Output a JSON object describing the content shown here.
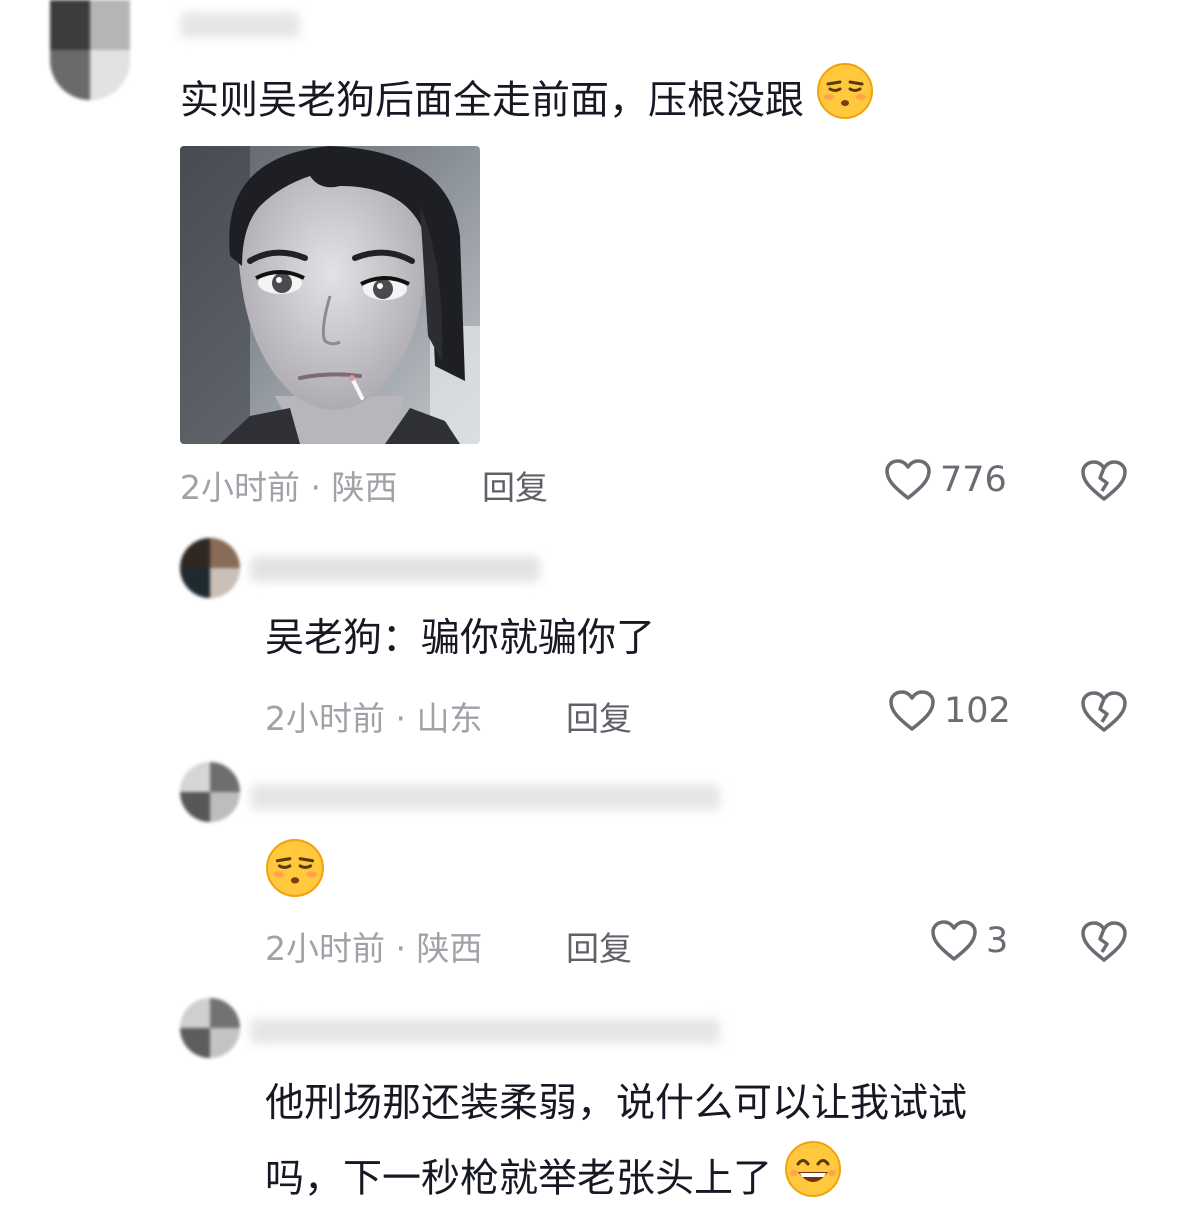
{
  "comments": [
    {
      "text": "实则吴老狗后面全走前面，压根没跟",
      "emoji": "smirk-emoji",
      "meta": "2小时前 · 陕西",
      "reply": "回复",
      "likes": "776"
    },
    {
      "text": "吴老狗：骗你就骗你了",
      "meta": "2小时前 · 山东",
      "reply": "回复",
      "likes": "102"
    },
    {
      "text": "",
      "emoji": "smirk-emoji",
      "meta": "2小时前 · 陕西",
      "reply": "回复",
      "likes": "3"
    },
    {
      "text_line1": "他刑场那还装柔弱，说什么可以让我试试",
      "text_line2": "吗，下一秒枪就举老张头上了",
      "emoji": "grin-emoji"
    }
  ],
  "colors": {
    "text": "#161823",
    "meta": "#a0a2a8",
    "reply": "#5f6068",
    "icon": "#6b6c73"
  }
}
